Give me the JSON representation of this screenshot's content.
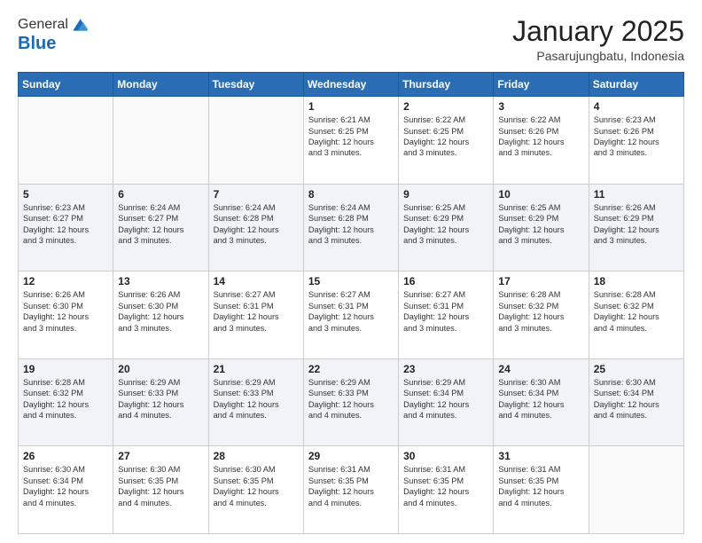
{
  "header": {
    "logo": {
      "line1": "General",
      "line2": "Blue"
    },
    "title": "January 2025",
    "subtitle": "Pasarujungbatu, Indonesia"
  },
  "calendar": {
    "days_of_week": [
      "Sunday",
      "Monday",
      "Tuesday",
      "Wednesday",
      "Thursday",
      "Friday",
      "Saturday"
    ],
    "weeks": [
      [
        {
          "day": "",
          "info": ""
        },
        {
          "day": "",
          "info": ""
        },
        {
          "day": "",
          "info": ""
        },
        {
          "day": "1",
          "info": "Sunrise: 6:21 AM\nSunset: 6:25 PM\nDaylight: 12 hours\nand 3 minutes."
        },
        {
          "day": "2",
          "info": "Sunrise: 6:22 AM\nSunset: 6:25 PM\nDaylight: 12 hours\nand 3 minutes."
        },
        {
          "day": "3",
          "info": "Sunrise: 6:22 AM\nSunset: 6:26 PM\nDaylight: 12 hours\nand 3 minutes."
        },
        {
          "day": "4",
          "info": "Sunrise: 6:23 AM\nSunset: 6:26 PM\nDaylight: 12 hours\nand 3 minutes."
        }
      ],
      [
        {
          "day": "5",
          "info": "Sunrise: 6:23 AM\nSunset: 6:27 PM\nDaylight: 12 hours\nand 3 minutes."
        },
        {
          "day": "6",
          "info": "Sunrise: 6:24 AM\nSunset: 6:27 PM\nDaylight: 12 hours\nand 3 minutes."
        },
        {
          "day": "7",
          "info": "Sunrise: 6:24 AM\nSunset: 6:28 PM\nDaylight: 12 hours\nand 3 minutes."
        },
        {
          "day": "8",
          "info": "Sunrise: 6:24 AM\nSunset: 6:28 PM\nDaylight: 12 hours\nand 3 minutes."
        },
        {
          "day": "9",
          "info": "Sunrise: 6:25 AM\nSunset: 6:29 PM\nDaylight: 12 hours\nand 3 minutes."
        },
        {
          "day": "10",
          "info": "Sunrise: 6:25 AM\nSunset: 6:29 PM\nDaylight: 12 hours\nand 3 minutes."
        },
        {
          "day": "11",
          "info": "Sunrise: 6:26 AM\nSunset: 6:29 PM\nDaylight: 12 hours\nand 3 minutes."
        }
      ],
      [
        {
          "day": "12",
          "info": "Sunrise: 6:26 AM\nSunset: 6:30 PM\nDaylight: 12 hours\nand 3 minutes."
        },
        {
          "day": "13",
          "info": "Sunrise: 6:26 AM\nSunset: 6:30 PM\nDaylight: 12 hours\nand 3 minutes."
        },
        {
          "day": "14",
          "info": "Sunrise: 6:27 AM\nSunset: 6:31 PM\nDaylight: 12 hours\nand 3 minutes."
        },
        {
          "day": "15",
          "info": "Sunrise: 6:27 AM\nSunset: 6:31 PM\nDaylight: 12 hours\nand 3 minutes."
        },
        {
          "day": "16",
          "info": "Sunrise: 6:27 AM\nSunset: 6:31 PM\nDaylight: 12 hours\nand 3 minutes."
        },
        {
          "day": "17",
          "info": "Sunrise: 6:28 AM\nSunset: 6:32 PM\nDaylight: 12 hours\nand 3 minutes."
        },
        {
          "day": "18",
          "info": "Sunrise: 6:28 AM\nSunset: 6:32 PM\nDaylight: 12 hours\nand 4 minutes."
        }
      ],
      [
        {
          "day": "19",
          "info": "Sunrise: 6:28 AM\nSunset: 6:32 PM\nDaylight: 12 hours\nand 4 minutes."
        },
        {
          "day": "20",
          "info": "Sunrise: 6:29 AM\nSunset: 6:33 PM\nDaylight: 12 hours\nand 4 minutes."
        },
        {
          "day": "21",
          "info": "Sunrise: 6:29 AM\nSunset: 6:33 PM\nDaylight: 12 hours\nand 4 minutes."
        },
        {
          "day": "22",
          "info": "Sunrise: 6:29 AM\nSunset: 6:33 PM\nDaylight: 12 hours\nand 4 minutes."
        },
        {
          "day": "23",
          "info": "Sunrise: 6:29 AM\nSunset: 6:34 PM\nDaylight: 12 hours\nand 4 minutes."
        },
        {
          "day": "24",
          "info": "Sunrise: 6:30 AM\nSunset: 6:34 PM\nDaylight: 12 hours\nand 4 minutes."
        },
        {
          "day": "25",
          "info": "Sunrise: 6:30 AM\nSunset: 6:34 PM\nDaylight: 12 hours\nand 4 minutes."
        }
      ],
      [
        {
          "day": "26",
          "info": "Sunrise: 6:30 AM\nSunset: 6:34 PM\nDaylight: 12 hours\nand 4 minutes."
        },
        {
          "day": "27",
          "info": "Sunrise: 6:30 AM\nSunset: 6:35 PM\nDaylight: 12 hours\nand 4 minutes."
        },
        {
          "day": "28",
          "info": "Sunrise: 6:30 AM\nSunset: 6:35 PM\nDaylight: 12 hours\nand 4 minutes."
        },
        {
          "day": "29",
          "info": "Sunrise: 6:31 AM\nSunset: 6:35 PM\nDaylight: 12 hours\nand 4 minutes."
        },
        {
          "day": "30",
          "info": "Sunrise: 6:31 AM\nSunset: 6:35 PM\nDaylight: 12 hours\nand 4 minutes."
        },
        {
          "day": "31",
          "info": "Sunrise: 6:31 AM\nSunset: 6:35 PM\nDaylight: 12 hours\nand 4 minutes."
        },
        {
          "day": "",
          "info": ""
        }
      ]
    ]
  }
}
